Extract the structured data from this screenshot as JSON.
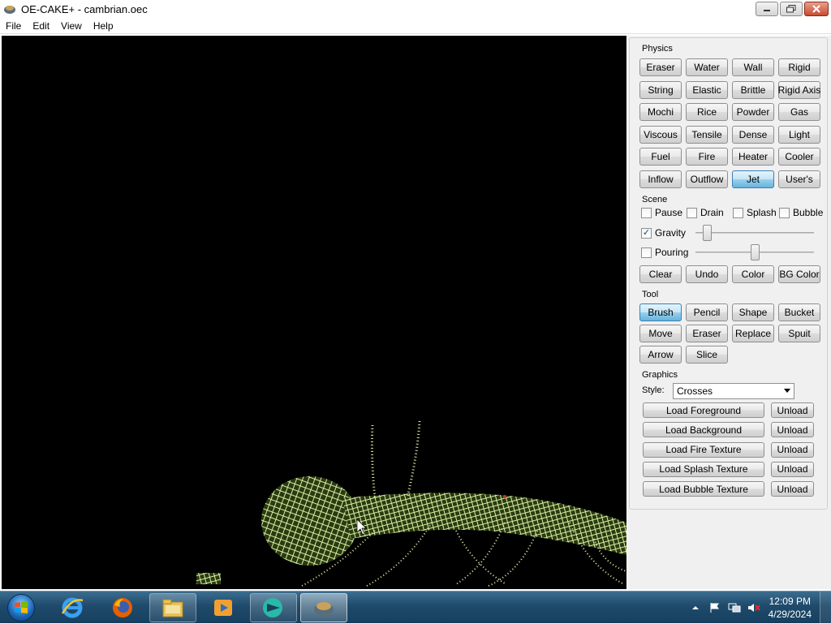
{
  "window": {
    "title": "OE-CAKE+ - cambrian.oec"
  },
  "menu": [
    "File",
    "Edit",
    "View",
    "Help"
  ],
  "physics": {
    "label": "Physics",
    "buttons": [
      "Eraser",
      "Water",
      "Wall",
      "Rigid",
      "String",
      "Elastic",
      "Brittle",
      "Rigid Axis",
      "Mochi",
      "Rice",
      "Powder",
      "Gas",
      "Viscous",
      "Tensile",
      "Dense",
      "Light",
      "Fuel",
      "Fire",
      "Heater",
      "Cooler",
      "Inflow",
      "Outflow",
      "Jet",
      "User's"
    ],
    "selected": "Jet"
  },
  "scene": {
    "label": "Scene",
    "checks": [
      {
        "label": "Pause",
        "checked": false
      },
      {
        "label": "Drain",
        "checked": false
      },
      {
        "label": "Splash",
        "checked": false
      },
      {
        "label": "Bubble",
        "checked": false
      }
    ],
    "gravity": {
      "label": "Gravity",
      "checked": true,
      "level": 0.07
    },
    "pouring": {
      "label": "Pouring",
      "checked": false,
      "level": 0.5
    },
    "buttons": [
      "Clear",
      "Undo",
      "Color",
      "BG Color"
    ]
  },
  "tool": {
    "label": "Tool",
    "buttons": [
      "Brush",
      "Pencil",
      "Shape",
      "Bucket",
      "Move",
      "Eraser",
      "Replace",
      "Spuit",
      "Arrow",
      "Slice"
    ],
    "selected": "Brush"
  },
  "graphics": {
    "label": "Graphics",
    "style_label": "Style:",
    "style_value": "Crosses",
    "loaders": [
      {
        "load": "Load Foreground",
        "unload": "Unload"
      },
      {
        "load": "Load Background",
        "unload": "Unload"
      },
      {
        "load": "Load Fire Texture",
        "unload": "Unload"
      },
      {
        "load": "Load Splash Texture",
        "unload": "Unload"
      },
      {
        "load": "Load Bubble Texture",
        "unload": "Unload"
      }
    ]
  },
  "colors": {
    "particle": "#d8f0a0",
    "particle_body": "#b8e07a",
    "canvas_bg": "#000000",
    "accent": "#3c7fb1"
  },
  "taskbar": {
    "apps": [
      "internet-explorer-icon",
      "firefox-icon",
      "file-explorer-icon",
      "media-player-icon",
      "oe-cake-app-icon",
      "oe-cake-window-icon"
    ],
    "time": "12:09 PM",
    "date": "4/29/2024"
  }
}
